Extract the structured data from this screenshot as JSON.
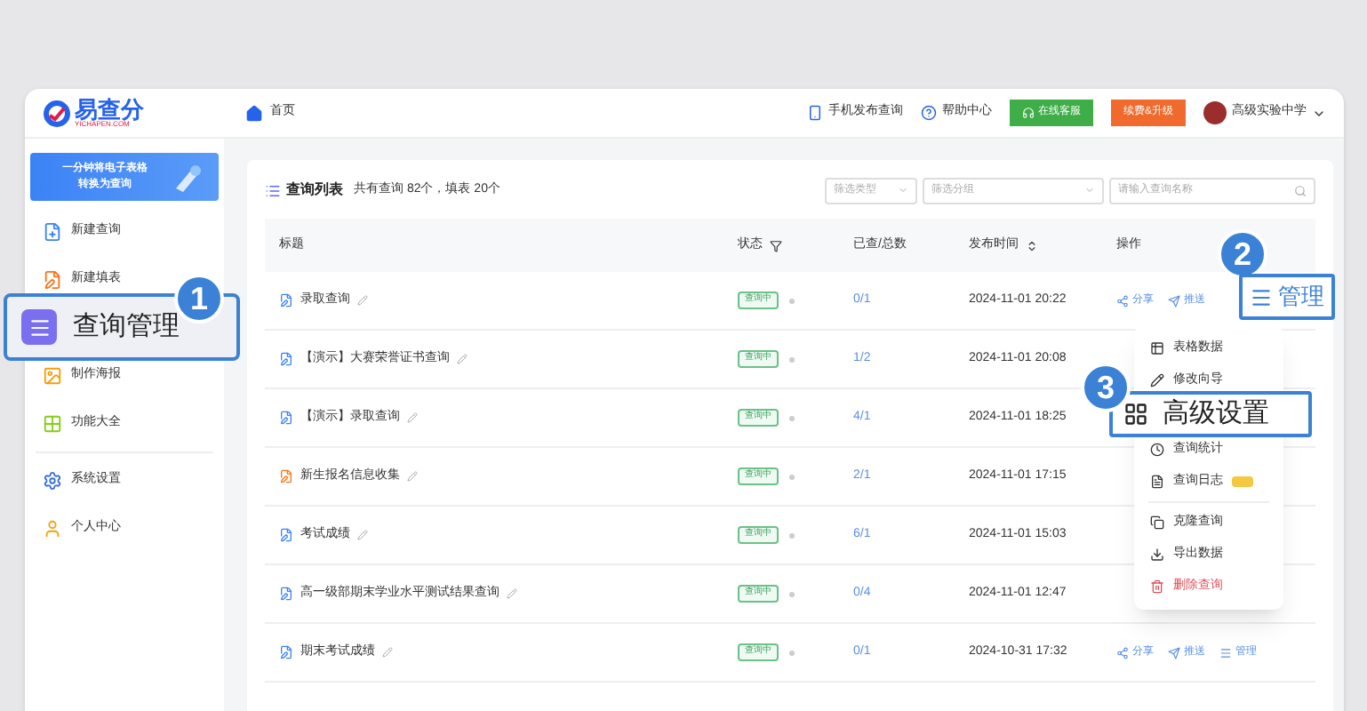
{
  "header": {
    "logo": "易查分",
    "logo_sub": "YICHAPEN.COM",
    "breadcrumb": "首页",
    "links": [
      "手机发布查询",
      "帮助中心"
    ],
    "support_button": "在线客服",
    "upgrade_button": "续费&升级",
    "user": "高级实验中学"
  },
  "sidebar": {
    "promo": [
      "一分钟将电子表格",
      "转换为查询"
    ],
    "items": [
      {
        "label": "新建查询",
        "color": "#3b82f6"
      },
      {
        "label": "新建填表",
        "color": "#f97316"
      },
      {
        "label": "制作海报",
        "color": "#f59e0b"
      },
      {
        "label": "功能大全",
        "color": "#84cc16"
      },
      {
        "label": "系统设置",
        "color": "#3b6fd8"
      },
      {
        "label": "个人中心",
        "color": "#f59e0b"
      }
    ]
  },
  "list": {
    "title": "查询列表",
    "summary": "共有查询 82个，填表 20个",
    "filters": [
      {
        "placeholder": "筛选类型"
      },
      {
        "placeholder": "筛选分组"
      }
    ],
    "search": {
      "placeholder": "请输入查询名称"
    }
  },
  "table": {
    "columns": [
      "标题",
      "状态",
      "已查/总数",
      "发布时间",
      "操作"
    ],
    "rows": [
      {
        "title": "录取查询",
        "color": "#3b82f6",
        "status": "查询中",
        "count": "0/1",
        "time": "2024-11-01 20:22",
        "actions": [
          "分享",
          "推送"
        ]
      },
      {
        "title": "【演示】大赛荣誉证书查询",
        "color": "#3b82f6",
        "status": "查询中",
        "count": "1/2",
        "time": "2024-11-01 20:08",
        "actions": []
      },
      {
        "title": "【演示】录取查询",
        "color": "#3b82f6",
        "status": "查询中",
        "count": "4/1",
        "time": "2024-11-01 18:25",
        "actions": []
      },
      {
        "title": "新生报名信息收集",
        "color": "#f97316",
        "status": "查询中",
        "count": "2/1",
        "time": "2024-11-01 17:15",
        "actions": []
      },
      {
        "title": "考试成绩",
        "color": "#3b82f6",
        "status": "查询中",
        "count": "6/1",
        "time": "2024-11-01 15:03",
        "actions": []
      },
      {
        "title": "高一级部期末学业水平测试结果查询",
        "color": "#3b82f6",
        "status": "查询中",
        "count": "0/4",
        "time": "2024-11-01 12:47",
        "actions": []
      },
      {
        "title": "期末考试成绩",
        "color": "#3b82f6",
        "status": "查询中",
        "count": "0/1",
        "time": "2024-10-31 17:32",
        "actions": [
          "分享",
          "推送",
          "管理"
        ]
      }
    ]
  },
  "menu": {
    "items": [
      {
        "label": "表格数据",
        "kind": "table"
      },
      {
        "label": "修改向导",
        "kind": "edit"
      },
      {
        "label": "查询统计",
        "kind": "stats"
      },
      {
        "label": "查询日志",
        "kind": "log",
        "badge": true
      },
      {
        "label": "克隆查询",
        "kind": "clone",
        "divider": true
      },
      {
        "label": "导出数据",
        "kind": "export"
      },
      {
        "label": "删除查询",
        "kind": "delete",
        "danger": true
      }
    ]
  },
  "callouts": [
    {
      "number": "1",
      "label": "查询管理",
      "kind": "sidebar"
    },
    {
      "number": "2",
      "label": "管理",
      "kind": "action"
    },
    {
      "number": "3",
      "label": "高级设置",
      "kind": "menu"
    }
  ]
}
